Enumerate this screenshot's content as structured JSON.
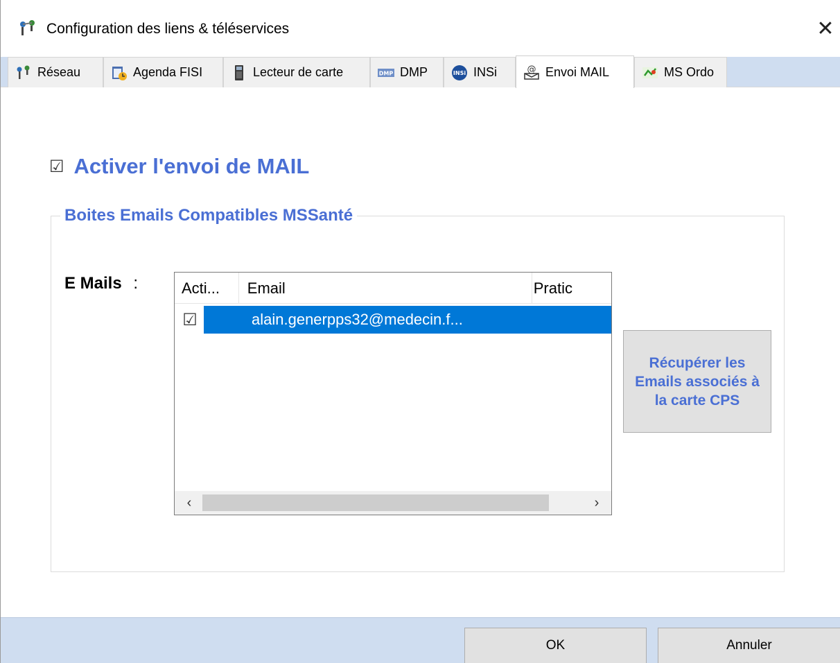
{
  "window": {
    "title": "Configuration des liens & téléservices",
    "close_glyph": "✕"
  },
  "tabs": [
    {
      "label": "Réseau",
      "icon": "network-icon"
    },
    {
      "label": "Agenda FISI",
      "icon": "agenda-icon"
    },
    {
      "label": "Lecteur de carte",
      "icon": "card-reader-icon"
    },
    {
      "label": "DMP",
      "icon": "dmp-icon",
      "icon_text": "DMP"
    },
    {
      "label": "INSi",
      "icon": "insi-icon",
      "icon_text": "INSi"
    },
    {
      "label": "Envoi MAIL",
      "icon": "mail-icon",
      "active": true
    },
    {
      "label": "MS Ordo",
      "icon": "ms-ordo-icon"
    }
  ],
  "mail": {
    "activate_label": "Activer l'envoi de MAIL",
    "activate_checked": true,
    "group_title": "Boites Emails Compatibles MSSanté",
    "emails_label": "E Mails",
    "emails_colon": ":",
    "columns": [
      "Acti...",
      "Email",
      "Pratic"
    ],
    "rows": [
      {
        "active": true,
        "email": "alain.generpps32@medecin.f..."
      }
    ],
    "scroll_left": "‹",
    "scroll_right": "›",
    "recup_button": "Récupérer les Emails associés à la carte CPS"
  },
  "footer": {
    "ok_label": "OK",
    "cancel_label": "Annuler"
  },
  "colors": {
    "accent_blue": "#4a6fd4",
    "selection": "#0078d7",
    "tabstrip_bg": "#cfddf0"
  }
}
